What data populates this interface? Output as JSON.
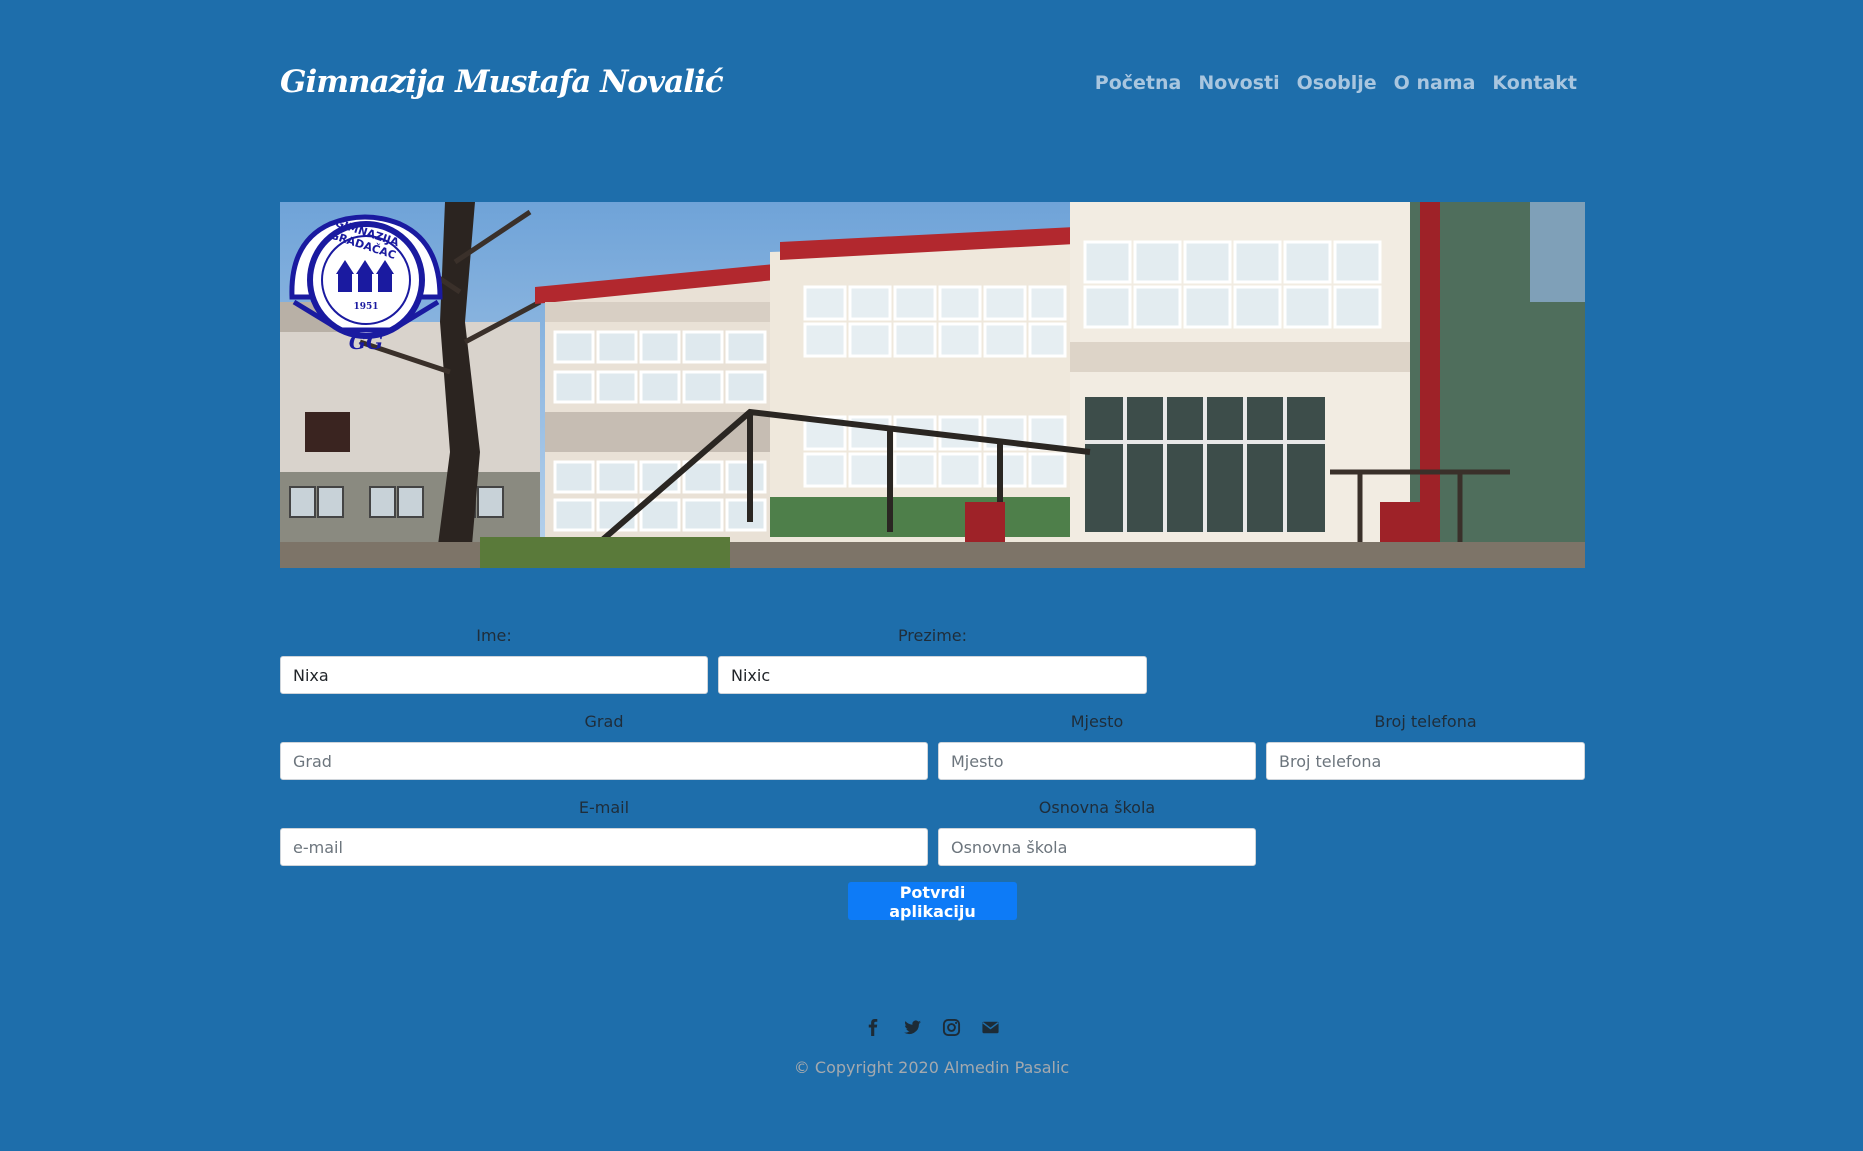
{
  "header": {
    "brand": "Gimnazija Mustafa Novalić",
    "nav": [
      "Početna",
      "Novosti",
      "Osoblje",
      "O nama",
      "Kontakt"
    ]
  },
  "hero": {
    "logo_text": "GIMNAZIJA GRADAČAC",
    "logo_year": "1951",
    "logo_monogram": "GG"
  },
  "form": {
    "ime": {
      "label": "Ime:",
      "value": "Nixa"
    },
    "prezime": {
      "label": "Prezime:",
      "value": "Nixic"
    },
    "grad": {
      "label": "Grad",
      "placeholder": "Grad"
    },
    "mjesto": {
      "label": "Mjesto",
      "placeholder": "Mjesto"
    },
    "telefon": {
      "label": "Broj telefona",
      "placeholder": "Broj telefona"
    },
    "email": {
      "label": "E-mail",
      "placeholder": "e-mail"
    },
    "skola": {
      "label": "Osnovna škola",
      "placeholder": "Osnovna škola"
    },
    "submit": "Potvrdi aplikaciju"
  },
  "footer": {
    "social": [
      "facebook-icon",
      "twitter-icon",
      "instagram-icon",
      "envelope-icon"
    ],
    "copyright": "© Copyright 2020 Almedin Pasalic"
  },
  "colors": {
    "background": "#1e6eab",
    "nav_link": "#a9c6df",
    "button": "#0d7bf7",
    "logo_blue": "#1a1aa0"
  }
}
